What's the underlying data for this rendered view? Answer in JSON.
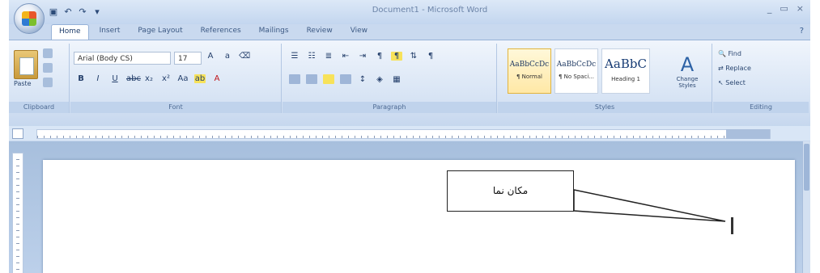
{
  "app": {
    "title": "Document1 - Microsoft Word",
    "quick_access": [
      "save-icon",
      "undo-icon",
      "redo-icon",
      "customize-icon"
    ],
    "window_controls": [
      "_",
      "▭",
      "×"
    ]
  },
  "tabs": [
    "Home",
    "Insert",
    "Page Layout",
    "References",
    "Mailings",
    "Review",
    "View"
  ],
  "ribbon": {
    "clipboard": {
      "paste_label": "Paste",
      "group_label": "Clipboard"
    },
    "font": {
      "font_name": "Arial (Body CS)",
      "font_size": "17",
      "group_label": "Font"
    },
    "paragraph": {
      "group_label": "Paragraph"
    },
    "styles": {
      "items": [
        {
          "preview": "AaBbCcDc",
          "name": "¶ Normal"
        },
        {
          "preview": "AaBbCcDc",
          "name": "¶ No Spaci..."
        },
        {
          "preview": "AaBbC",
          "name": "Heading 1"
        }
      ],
      "change_styles": "Change Styles",
      "group_label": "Styles"
    },
    "editing": {
      "find": "Find",
      "replace": "Replace",
      "select": "Select",
      "group_label": "Editing"
    }
  },
  "callout": {
    "text": "مکان نما"
  },
  "colors": {
    "ribbon_bg": "#d6e3f4",
    "accent": "#e2b43c",
    "doc_bg": "#a7bfdd"
  }
}
